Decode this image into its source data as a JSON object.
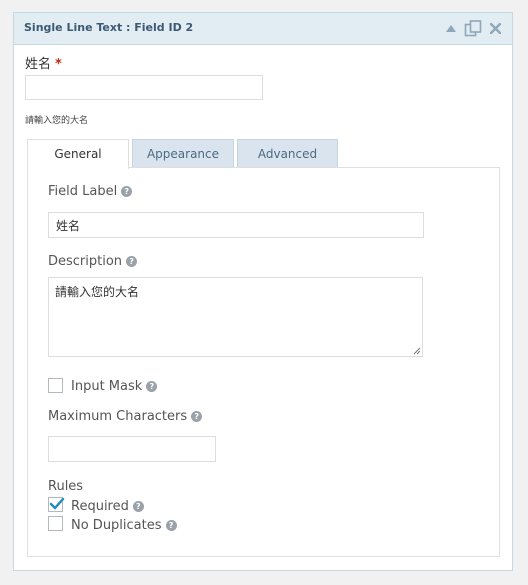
{
  "panel": {
    "title": "Single Line Text : Field ID 2",
    "icons": [
      "collapse-arrow-icon",
      "duplicate-icon",
      "close-icon"
    ]
  },
  "preview": {
    "label": "姓名",
    "required_marker": "*",
    "input_value": "",
    "description": "請輸入您的大名"
  },
  "tabs": [
    {
      "label": "General",
      "active": true
    },
    {
      "label": "Appearance",
      "active": false
    },
    {
      "label": "Advanced",
      "active": false
    }
  ],
  "settings": {
    "field_label": {
      "label": "Field Label",
      "value": "姓名"
    },
    "description": {
      "label": "Description",
      "value": "請輸入您的大名"
    },
    "input_mask": {
      "label": "Input Mask",
      "checked": false
    },
    "max_chars": {
      "label": "Maximum Characters",
      "value": ""
    },
    "rules": {
      "heading": "Rules",
      "required": {
        "label": "Required",
        "checked": true
      },
      "no_duplicates": {
        "label": "No Duplicates",
        "checked": false
      }
    }
  },
  "help_icon_glyph": "?",
  "colors": {
    "header_bg": "#e1ecf3",
    "title_color": "#3c5a73",
    "required_star": "#c02b0a",
    "checkmark": "#1e8cbe"
  }
}
